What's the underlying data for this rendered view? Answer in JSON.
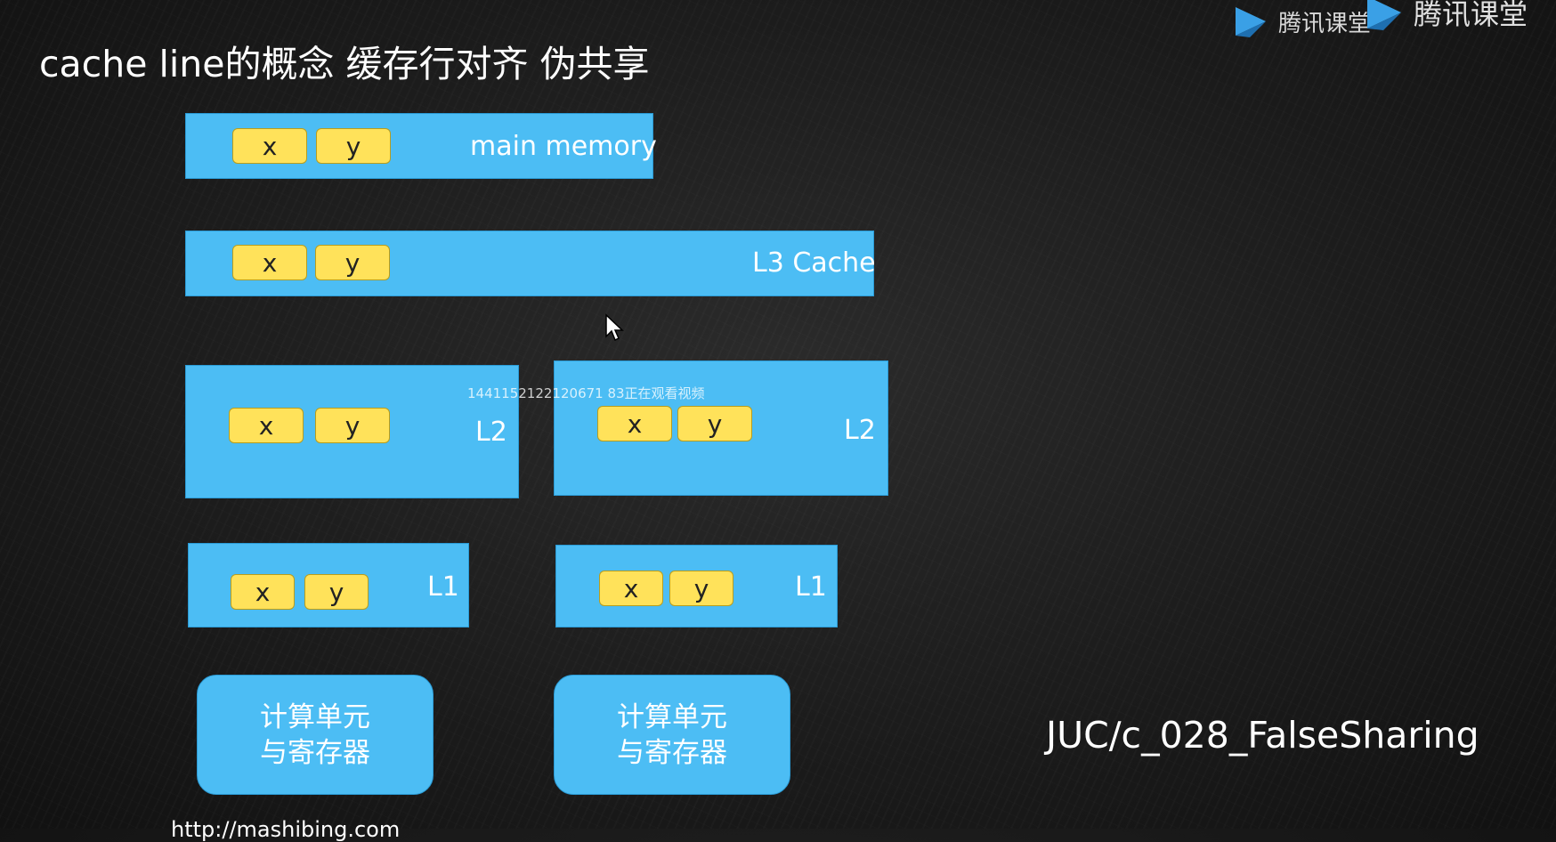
{
  "title": "cache line的概念 缓存行对齐 伪共享",
  "brand": {
    "logo_small": "腾讯课堂",
    "logo_large": "腾讯课堂"
  },
  "cell_labels": {
    "x": "x",
    "y": "y"
  },
  "levels": {
    "main_memory": "main memory",
    "l3": "L3 Cache",
    "l2_left": "L2",
    "l2_right": "L2",
    "l1_left": "L1",
    "l1_right": "L1"
  },
  "compute_unit": {
    "line1": "计算单元",
    "line2": "与寄存器"
  },
  "watermark": "1441152122120671 83正在观看视频",
  "code_reference": "JUC/c_028_FalseSharing",
  "url": "http://mashibing.com",
  "colors": {
    "box": "#4cbdf4",
    "cell": "#ffe25a",
    "background": "#1c1c1c"
  }
}
